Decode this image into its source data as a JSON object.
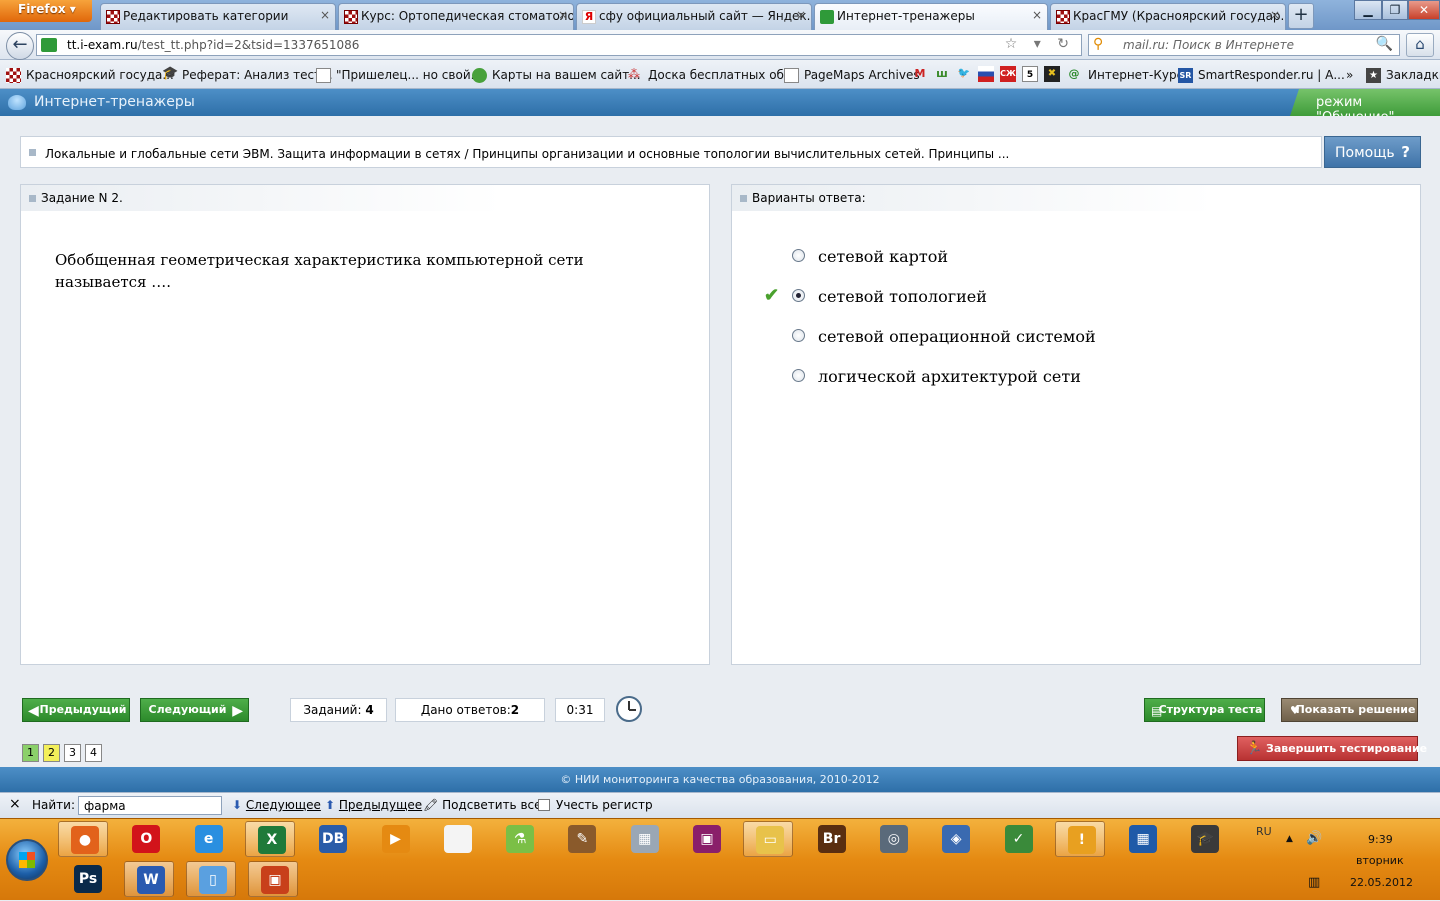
{
  "browser": {
    "menu_label": "Firefox",
    "tabs": [
      {
        "label": "Редактировать категории",
        "icon": "checkered-favicon",
        "close": "×"
      },
      {
        "label": "Курс: Ортопедическая стоматоло...",
        "icon": "checkered-favicon",
        "close": "×"
      },
      {
        "label": "сфу официальный сайт — Яндек...",
        "icon": "yandex-favicon",
        "favicon_text": "Я",
        "close": "×"
      },
      {
        "label": "Интернет-тренажеры",
        "icon": "i-exam-favicon",
        "close": "×",
        "active": true
      },
      {
        "label": "КрасГМУ (Красноярский государ...",
        "icon": "checkered-favicon",
        "close": "×"
      }
    ],
    "new_tab": "+",
    "window_controls": {
      "minimize": "▁",
      "maximize": "❐",
      "close": "✕"
    },
    "back": "←",
    "url_domain": "tt.i-exam.ru",
    "url_path": "/test_tt.php?id=2&tsid=1337651086",
    "url_icons": "☆ ▾ ↻",
    "search_placeholder": "mail.ru: Поиск в Интернете",
    "search_icon": "⚲",
    "search_go": "🔍",
    "home": "⌂",
    "bookmarks": [
      {
        "label": "Красноярский госуда...",
        "icon": "checkered-favicon"
      },
      {
        "label": "Реферат: Анализ тест...",
        "icon": "graduation-cap-icon"
      },
      {
        "label": "\"Пришелец... но свой...",
        "icon": "blank-page-icon"
      },
      {
        "label": "Карты на вашем сайт...",
        "icon": "green-circle-icon"
      },
      {
        "label": "Доска бесплатных об...",
        "icon": "people-icon"
      },
      {
        "label": "PageMaps Archives",
        "icon": "blank-page-icon"
      },
      {
        "label": "Интернет-Курс",
        "icon": "at-icon"
      },
      {
        "label": "SmartResponder.ru | А...",
        "icon": "sr-icon",
        "icon_text": "SR"
      },
      {
        "label": "Закладки",
        "icon": "bookmarks-icon"
      }
    ],
    "bookmark_small_icons": [
      "M",
      "ш",
      "🐦",
      "▬",
      "СЖ",
      "5",
      "✖",
      "@"
    ],
    "bookmarks_more": "»"
  },
  "site": {
    "header_title": "Интернет-тренажеры",
    "mode_label": "режим \"Обучение\"",
    "breadcrumb": "Локальные и глобальные сети ЭВМ. Защита информации в сетях / Принципы организации и основные топологии вычислительных сетей. Принципы ...",
    "help_label": "Помощь",
    "help_icon": "?",
    "task_header": "Задание N 2.",
    "question": "Обобщенная геометрическая характеристика компьютерной сети называется ….",
    "answers_header": "Варианты ответа:",
    "answers": [
      {
        "label": "сетевой картой",
        "selected": false
      },
      {
        "label": "сетевой топологией",
        "selected": true,
        "check": "✔"
      },
      {
        "label": "сетевой операционной системой",
        "selected": false
      },
      {
        "label": "логической архитектурой сети",
        "selected": false
      }
    ],
    "prev_label": "Предыдущий",
    "next_label": "Следующий",
    "prev_arrow": "◀",
    "next_arrow": "▶",
    "tasks_label": "Заданий:",
    "tasks_count": "4",
    "answered_label": "Дано ответов:",
    "answered_count": "2",
    "timer": "0:31",
    "structure_label": "Структура теста",
    "structure_icon": "▤",
    "show_solution_label": "Показать решение",
    "show_solution_icon": "♥",
    "finish_label": "Завершить тестирование",
    "finish_icon": "🏃",
    "pages": [
      "1",
      "2",
      "3",
      "4"
    ],
    "footer": "© НИИ мониторинга качества образования, 2010-2012"
  },
  "findbar": {
    "close": "×",
    "label": "Найти:",
    "value": "фарма",
    "next_icon": "⬇",
    "next": "Следующее",
    "prev_icon": "⬆",
    "prev": "Предыдущее",
    "highlight_icon": "🖍",
    "highlight": "Подсветить все",
    "match_case": "Учесть регистр"
  },
  "taskbar": {
    "apps_row1": [
      {
        "name": "firefox",
        "glyph": "●",
        "color": "#e2621b",
        "active": true
      },
      {
        "name": "opera",
        "glyph": "O",
        "color": "#d2131a"
      },
      {
        "name": "internet-explorer",
        "glyph": "e",
        "color": "#2a8fe0"
      },
      {
        "name": "excel",
        "glyph": "X",
        "color": "#1f7a3a",
        "active": true
      },
      {
        "name": "daemon-tools",
        "glyph": "DB",
        "color": "#2a5ca8"
      },
      {
        "name": "media-player",
        "glyph": "▶",
        "color": "#e58a12"
      },
      {
        "name": "document",
        "glyph": "",
        "color": "#f4f4f4"
      },
      {
        "name": "chemistry-app",
        "glyph": "⚗",
        "color": "#7bbf46"
      },
      {
        "name": "writing-app",
        "glyph": "✎",
        "color": "#8a5a2b"
      },
      {
        "name": "calculator",
        "glyph": "▦",
        "color": "#9aa7b5"
      },
      {
        "name": "floppy-save",
        "glyph": "▣",
        "color": "#8a1f6a"
      },
      {
        "name": "file-explorer",
        "glyph": "▭",
        "color": "#e8c24a",
        "active": true
      },
      {
        "name": "adobe-bridge",
        "glyph": "Br",
        "color": "#5a2e10"
      },
      {
        "name": "disc-burner",
        "glyph": "◎",
        "color": "#5a6a7a"
      },
      {
        "name": "network-tool",
        "glyph": "◈",
        "color": "#3a6ab0"
      },
      {
        "name": "security-shield",
        "glyph": "✓",
        "color": "#3a8a3a"
      },
      {
        "name": "warning-disc",
        "glyph": "!",
        "color": "#e8a020",
        "active": true
      },
      {
        "name": "tiles-app",
        "glyph": "▦",
        "color": "#1f5aa8"
      },
      {
        "name": "education-app",
        "glyph": "🎓",
        "color": "#3a3a3a"
      }
    ],
    "apps_row2": [
      {
        "name": "photoshop",
        "glyph": "Ps",
        "color": "#0a2a4a"
      },
      {
        "name": "word",
        "glyph": "W",
        "color": "#2a5ab0",
        "active": true
      },
      {
        "name": "windows-explorer",
        "glyph": "▯",
        "color": "#5aa0e0",
        "active": true
      },
      {
        "name": "powerpoint",
        "glyph": "▣",
        "color": "#c8401a",
        "active": true
      }
    ],
    "lang": "RU",
    "tray_arrow": "▲",
    "volume": "🔊",
    "network": "▥",
    "time": "9:39",
    "day": "вторник",
    "date": "22.05.2012"
  }
}
